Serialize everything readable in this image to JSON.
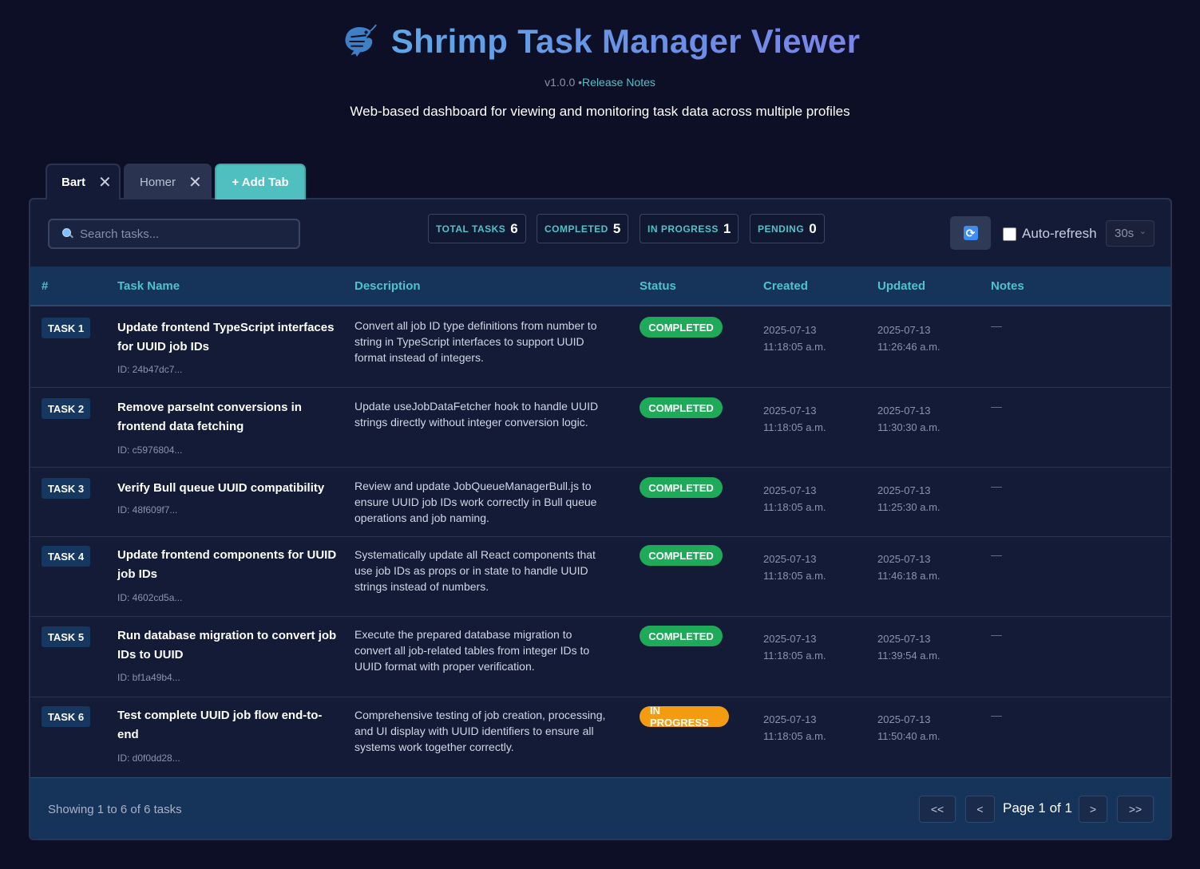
{
  "header": {
    "title": "Shrimp Task Manager Viewer",
    "version": "v1.0.0",
    "separator": "•",
    "release_notes": "Release Notes",
    "subtitle": "Web-based dashboard for viewing and monitoring task data across multiple profiles",
    "logo_icon": "shrimp-icon"
  },
  "tabs": [
    {
      "label": "Bart",
      "active": true
    },
    {
      "label": "Homer",
      "active": false
    }
  ],
  "add_tab_label": "+ Add Tab",
  "search": {
    "placeholder": "Search tasks..."
  },
  "stats": {
    "total": {
      "label": "TOTAL TASKS",
      "value": "6"
    },
    "completed": {
      "label": "COMPLETED",
      "value": "5"
    },
    "in_progress": {
      "label": "IN PROGRESS",
      "value": "1"
    },
    "pending": {
      "label": "PENDING",
      "value": "0"
    }
  },
  "refresh": {
    "icon": "refresh-icon",
    "glyph": "⟳"
  },
  "auto_refresh": {
    "label": "Auto-refresh",
    "checked": false,
    "interval": "30s"
  },
  "columns": [
    "#",
    "Task Name",
    "Description",
    "Status",
    "Created",
    "Updated",
    "Notes"
  ],
  "tasks": [
    {
      "badge": "TASK 1",
      "name": "Update frontend TypeScript interfaces for UUID job IDs",
      "id": "ID: 24b47dc7...",
      "description": "Convert all job ID type definitions from number to string in TypeScript interfaces to support UUID format instead of integers.",
      "status": "COMPLETED",
      "created_date": "2025-07-13",
      "created_time": "11:18:05 a.m.",
      "updated_date": "2025-07-13",
      "updated_time": "11:26:46 a.m.",
      "notes": "—"
    },
    {
      "badge": "TASK 2",
      "name": "Remove parseInt conversions in frontend data fetching",
      "id": "ID: c5976804...",
      "description": "Update useJobDataFetcher hook to handle UUID strings directly without integer conversion logic.",
      "status": "COMPLETED",
      "created_date": "2025-07-13",
      "created_time": "11:18:05 a.m.",
      "updated_date": "2025-07-13",
      "updated_time": "11:30:30 a.m.",
      "notes": "—"
    },
    {
      "badge": "TASK 3",
      "name": "Verify Bull queue UUID compatibility",
      "id": "ID: 48f609f7...",
      "description": "Review and update JobQueueManagerBull.js to ensure UUID job IDs work correctly in Bull queue operations and job naming.",
      "status": "COMPLETED",
      "created_date": "2025-07-13",
      "created_time": "11:18:05 a.m.",
      "updated_date": "2025-07-13",
      "updated_time": "11:25:30 a.m.",
      "notes": "—"
    },
    {
      "badge": "TASK 4",
      "name": "Update frontend components for UUID job IDs",
      "id": "ID: 4602cd5a...",
      "description": "Systematically update all React components that use job IDs as props or in state to handle UUID strings instead of numbers.",
      "status": "COMPLETED",
      "created_date": "2025-07-13",
      "created_time": "11:18:05 a.m.",
      "updated_date": "2025-07-13",
      "updated_time": "11:46:18 a.m.",
      "notes": "—"
    },
    {
      "badge": "TASK 5",
      "name": "Run database migration to convert job IDs to UUID",
      "id": "ID: bf1a49b4...",
      "description": "Execute the prepared database migration to convert all job-related tables from integer IDs to UUID format with proper verification.",
      "status": "COMPLETED",
      "created_date": "2025-07-13",
      "created_time": "11:18:05 a.m.",
      "updated_date": "2025-07-13",
      "updated_time": "11:39:54 a.m.",
      "notes": "—"
    },
    {
      "badge": "TASK 6",
      "name": "Test complete UUID job flow end-to-end",
      "id": "ID: d0f0dd28...",
      "description": "Comprehensive testing of job creation, processing, and UI display with UUID identifiers to ensure all systems work together correctly.",
      "status": "IN PROGRESS",
      "created_date": "2025-07-13",
      "created_time": "11:18:05 a.m.",
      "updated_date": "2025-07-13",
      "updated_time": "11:50:40 a.m.",
      "notes": "—"
    }
  ],
  "footer": {
    "showing": "Showing 1 to 6 of 6 tasks",
    "page_info": "Page 1 of 1",
    "first": "<<",
    "prev": "<",
    "next": ">",
    "last": ">>"
  },
  "colors": {
    "accent": "#4fc3c8",
    "completed": "#1faa5a",
    "in_progress": "#f39c12",
    "header_bg": "#16335a"
  }
}
